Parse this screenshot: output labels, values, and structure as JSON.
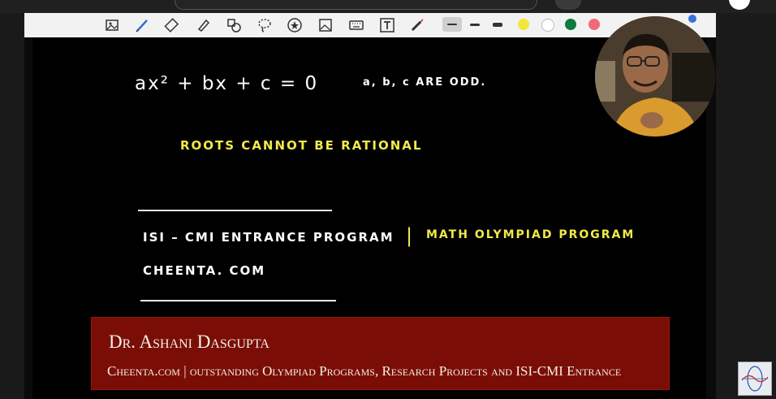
{
  "canvas": {
    "equation": "ax² + bx + c = 0",
    "condition": "a, b, c   ARE  ODD.",
    "statement": "ROOTS   CANNOT   BE   RATIONAL",
    "program_left": "ISI – CMI  ENTRANCE   PROGRAM",
    "separator": "|",
    "program_right": "MATH OLYMPIAD  PROGRAM",
    "website": "CHEENTA. COM"
  },
  "banner": {
    "name": "Dr. Ashani Dasgupta",
    "tagline": "Cheenta.com  |  outstanding Olympiad Programs, Research Projects and ISI-CMI Entrance"
  },
  "toolbar": {
    "tools": [
      "image-icon",
      "pen-icon",
      "eraser-icon",
      "highlighter-icon",
      "shapes-icon",
      "lasso-icon",
      "star-icon",
      "insert-image-icon",
      "keyboard-icon",
      "text-icon",
      "laser-icon"
    ],
    "colors": [
      "#f5e63a",
      "#ffffff",
      "#0f7a3d",
      "#f06a7a",
      "#111111",
      "#3a6fe0"
    ]
  }
}
